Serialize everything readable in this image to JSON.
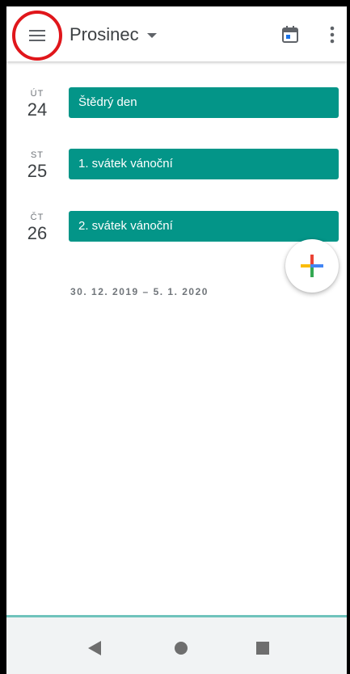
{
  "header": {
    "month": "Prosinec",
    "menu_icon": "hamburger-menu-icon",
    "today_icon": "calendar-today-icon",
    "more_icon": "more-vertical-icon",
    "highlight_color": "#e0161b"
  },
  "agenda": {
    "days": [
      {
        "dow": "ÚT",
        "date": "24",
        "event": "Štědrý den"
      },
      {
        "dow": "ST",
        "date": "25",
        "event": "1. svátek vánoční"
      },
      {
        "dow": "ČT",
        "date": "26",
        "event": "2. svátek vánoční"
      }
    ],
    "next_range": "30. 12. 2019 – 5. 1. 2020",
    "event_color": "#039588"
  },
  "fab": {
    "icon": "google-plus-icon"
  },
  "navigation": {
    "back_icon": "back-triangle-icon",
    "home_icon": "home-circle-icon",
    "recents_icon": "recents-square-icon"
  }
}
